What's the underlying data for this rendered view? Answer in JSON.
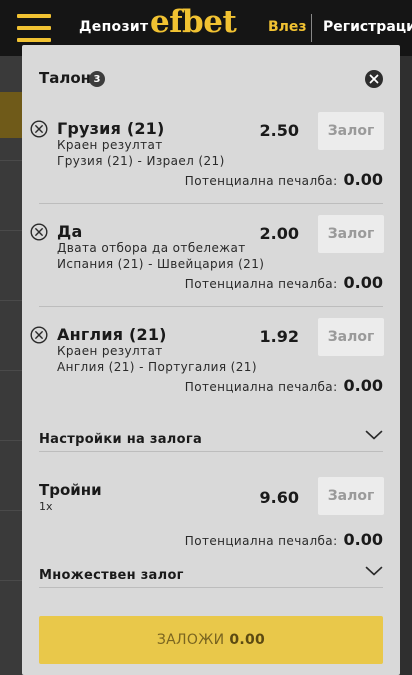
{
  "header": {
    "deposit_label": "Депозит",
    "logo": "efbet",
    "login_label": "Влез",
    "register_label": "Регистрация",
    "accent_color": "#f1c232"
  },
  "slip": {
    "title": "Талон",
    "count": "3",
    "icons": {
      "close": "close-icon",
      "remove": "remove-circle-icon",
      "expand": "chevron-down-icon"
    },
    "bets": [
      {
        "selection": "Грузия (21)",
        "market": "Краен резултат",
        "event": "Грузия (21) - Израел (21)",
        "odds": "2.50",
        "stake_label": "Залог",
        "payout_label": "Потенциална печалба:",
        "payout_value": "0.00"
      },
      {
        "selection": "Да",
        "market": "Двата отбора да отбележат",
        "event": "Испания (21) - Швейцария (21)",
        "odds": "2.00",
        "stake_label": "Залог",
        "payout_label": "Потенциална печалба:",
        "payout_value": "0.00"
      },
      {
        "selection": "Англия (21)",
        "market": "Краен резултат",
        "event": "Англия (21) - Португалия (21)",
        "odds": "1.92",
        "stake_label": "Залог",
        "payout_label": "Потенциална печалба:",
        "payout_value": "0.00"
      }
    ],
    "settings_label": "Настройки на залога",
    "combo": {
      "title": "Тройни",
      "subtitle": "1x",
      "odds": "9.60",
      "stake_label": "Залог",
      "payout_label": "Потенциална печалба:",
      "payout_value": "0.00"
    },
    "multiple_label": "Множествен залог",
    "place_label": "ЗАЛОЖИ",
    "place_amount": "0.00",
    "place_color": "#e9c84a"
  }
}
